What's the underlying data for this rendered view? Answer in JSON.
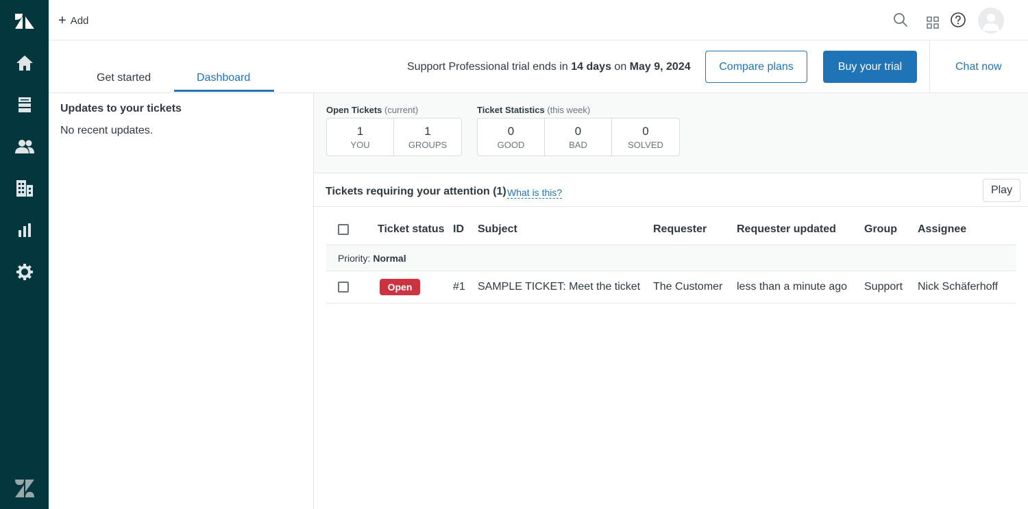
{
  "colors": {
    "sidebar_bg": "#03363d",
    "accent": "#1f73b7",
    "status_open": "#cc3340"
  },
  "topbar": {
    "add_label": "Add",
    "icons": [
      "search-icon",
      "apps-grid-icon",
      "help-icon",
      "user-avatar-icon"
    ]
  },
  "sidebar": {
    "items": [
      {
        "name": "home",
        "icon": "home-icon"
      },
      {
        "name": "views",
        "icon": "views-icon"
      },
      {
        "name": "customers",
        "icon": "customers-icon"
      },
      {
        "name": "organizations",
        "icon": "organizations-icon"
      },
      {
        "name": "reporting",
        "icon": "reporting-icon"
      },
      {
        "name": "admin",
        "icon": "gear-icon"
      }
    ]
  },
  "subheader": {
    "tabs": [
      {
        "label": "Get started",
        "active": false
      },
      {
        "label": "Dashboard",
        "active": true
      }
    ],
    "trial_prefix": "Support Professional trial ends in ",
    "trial_days": "14 days",
    "trial_mid": " on ",
    "trial_date": "May 9, 2024",
    "compare_label": "Compare plans",
    "buy_label": "Buy your trial",
    "chat_label": "Chat now"
  },
  "updates": {
    "title": "Updates to your tickets",
    "empty": "No recent updates."
  },
  "open_tickets": {
    "title": "Open Tickets",
    "qualifier": "(current)",
    "stats": [
      {
        "value": "1",
        "label": "YOU"
      },
      {
        "value": "1",
        "label": "GROUPS"
      }
    ]
  },
  "ticket_statistics": {
    "title": "Ticket Statistics",
    "qualifier": "(this week)",
    "stats": [
      {
        "value": "0",
        "label": "GOOD"
      },
      {
        "value": "0",
        "label": "BAD"
      },
      {
        "value": "0",
        "label": "SOLVED"
      }
    ]
  },
  "attention": {
    "title": "Tickets requiring your attention",
    "count": "(1)",
    "what_link": "What is this?",
    "play_label": "Play"
  },
  "table": {
    "headers": {
      "status": "Ticket status",
      "id": "ID",
      "subject": "Subject",
      "requester": "Requester",
      "requester_updated": "Requester updated",
      "group": "Group",
      "assignee": "Assignee"
    },
    "priority_label": "Priority:",
    "priority_value": "Normal",
    "rows": [
      {
        "status": "Open",
        "id": "#1",
        "subject": "SAMPLE TICKET: Meet the ticket",
        "requester": "The Customer",
        "requester_updated": "less than a minute ago",
        "group": "Support",
        "assignee": "Nick Schäferhoff"
      }
    ]
  }
}
